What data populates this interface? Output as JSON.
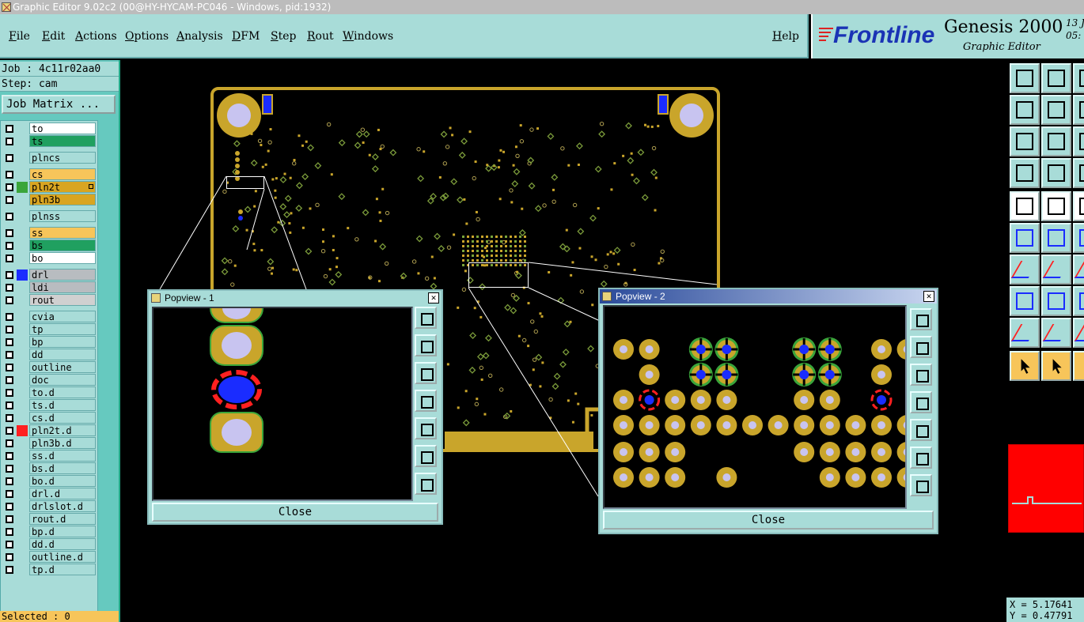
{
  "window": {
    "title": "Graphic Editor 9.02c2 (00@HY-HYCAM-PC046 - Windows, pid:1932)"
  },
  "menu": [
    "File",
    "Edit",
    "Actions",
    "Options",
    "Analysis",
    "DFM",
    "Step",
    "Rout",
    "Windows"
  ],
  "help": "Help",
  "logo": {
    "brand": "Frontline",
    "product": "Genesis 2000",
    "subtitle": "Graphic Editor",
    "date1": "13 J",
    "date2": "05:"
  },
  "job": {
    "job_line": "Job : 4c11r02aa0",
    "step_line": "Step: cam",
    "matrix_button": "Job Matrix ..."
  },
  "layers": [
    {
      "name": "to",
      "color": "#ffffff"
    },
    {
      "name": "ts",
      "color": "#20a060"
    },
    {
      "name": "plncs",
      "color": "#a8dcd8"
    },
    {
      "name": "cs",
      "color": "#f7c55a"
    },
    {
      "name": "pln2t",
      "color": "#d9a521",
      "active": true,
      "swatch": "#3aa53a"
    },
    {
      "name": "pln3b",
      "color": "#d9a521"
    },
    {
      "name": "plnss",
      "color": "#a8dcd8"
    },
    {
      "name": "ss",
      "color": "#f7c55a"
    },
    {
      "name": "bs",
      "color": "#20a060"
    },
    {
      "name": "bo",
      "color": "#ffffff"
    },
    {
      "name": "drl",
      "color": "#b8bcc0",
      "swatch": "#1a2cff"
    },
    {
      "name": "ldi",
      "color": "#b8bcc0"
    },
    {
      "name": "rout",
      "color": "#d0d0d0"
    },
    {
      "name": "cvia",
      "color": "#a8dcd8"
    },
    {
      "name": "tp",
      "color": "#a8dcd8"
    },
    {
      "name": "bp",
      "color": "#a8dcd8"
    },
    {
      "name": "dd",
      "color": "#a8dcd8"
    },
    {
      "name": "outline",
      "color": "#a8dcd8"
    },
    {
      "name": "doc",
      "color": "#a8dcd8"
    },
    {
      "name": "to.d",
      "color": "#a8dcd8"
    },
    {
      "name": "ts.d",
      "color": "#a8dcd8"
    },
    {
      "name": "cs.d",
      "color": "#a8dcd8"
    },
    {
      "name": "pln2t.d",
      "color": "#a8dcd8",
      "swatch": "#ff2020"
    },
    {
      "name": "pln3b.d",
      "color": "#a8dcd8"
    },
    {
      "name": "ss.d",
      "color": "#a8dcd8"
    },
    {
      "name": "bs.d",
      "color": "#a8dcd8"
    },
    {
      "name": "bo.d",
      "color": "#a8dcd8"
    },
    {
      "name": "drl.d",
      "color": "#a8dcd8"
    },
    {
      "name": "drlslot.d",
      "color": "#a8dcd8"
    },
    {
      "name": "rout.d",
      "color": "#a8dcd8"
    },
    {
      "name": "bp.d",
      "color": "#a8dcd8"
    },
    {
      "name": "dd.d",
      "color": "#a8dcd8"
    },
    {
      "name": "outline.d",
      "color": "#a8dcd8"
    },
    {
      "name": "tp.d",
      "color": "#a8dcd8"
    }
  ],
  "selected": "Selected : 0",
  "popview1": {
    "title": "Popview - 1",
    "close_label": "Close"
  },
  "popview2": {
    "title": "Popview - 2",
    "close_label": "Close"
  },
  "coords": {
    "x": "X = 5.17641",
    "y": "Y = 0.47791"
  },
  "colors": {
    "pad": "#c9a52b",
    "drill": "#c8c4f0",
    "via": "#1a2cff",
    "clearance": "#ff2020",
    "outline": "#3aa53a"
  }
}
